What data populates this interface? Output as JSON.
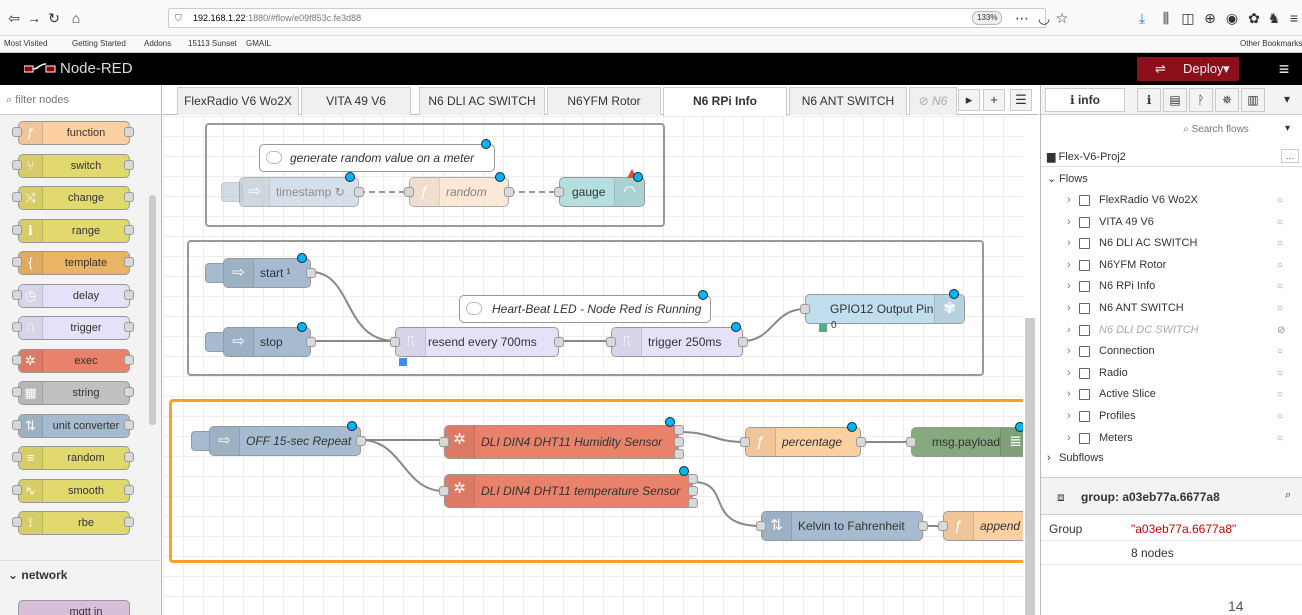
{
  "browser": {
    "url_host": "192.168.1.22",
    "url_path": ":1880/#flow/e09f853c.fe3d88",
    "zoom": "133%",
    "bookmarks": [
      "Most Visited",
      "Getting Started",
      "Addons",
      "15113 Sunset",
      "GMAIL"
    ],
    "other_bookmarks": "Other Bookmarks"
  },
  "header": {
    "title": "Node-RED",
    "deploy_label": "Deploy"
  },
  "palette": {
    "filter_placeholder": "filter nodes",
    "nodes": [
      {
        "label": "function",
        "color": "#fdd0a2",
        "icon": "function-icon",
        "glyph": "ƒ"
      },
      {
        "label": "switch",
        "color": "#e2d96e",
        "icon": "switch-icon",
        "glyph": "⑂"
      },
      {
        "label": "change",
        "color": "#e2d96e",
        "icon": "change-icon",
        "glyph": "⤨"
      },
      {
        "label": "range",
        "color": "#e2d96e",
        "icon": "range-icon",
        "glyph": "ℹ"
      },
      {
        "label": "template",
        "color": "#ebb464",
        "icon": "template-icon",
        "glyph": "{"
      },
      {
        "label": "delay",
        "color": "#e6e0f8",
        "icon": "delay-icon",
        "glyph": "◷"
      },
      {
        "label": "trigger",
        "color": "#e6e0f8",
        "icon": "trigger-icon",
        "glyph": "⎍"
      },
      {
        "label": "exec",
        "color": "#e8826b",
        "icon": "exec-icon",
        "glyph": "✲"
      },
      {
        "label": "string",
        "color": "#c0c0c0",
        "icon": "string-icon",
        "glyph": "▦"
      },
      {
        "label": "unit converter",
        "color": "#a6bbcf",
        "icon": "unit-converter-icon",
        "glyph": "⇅"
      },
      {
        "label": "random",
        "color": "#e2d96e",
        "icon": "random-icon",
        "glyph": "≡"
      },
      {
        "label": "smooth",
        "color": "#e2d96e",
        "icon": "smooth-icon",
        "glyph": "∿"
      },
      {
        "label": "rbe",
        "color": "#e2d96e",
        "icon": "rbe-icon",
        "glyph": "⟟"
      }
    ],
    "category": "network",
    "partial_node": "mqtt in"
  },
  "tabs": [
    {
      "label": "FlexRadio V6 Wo2X",
      "active": false
    },
    {
      "label": "VITA 49 V6",
      "active": false
    },
    {
      "label": "N6 DLI AC SWITCH",
      "active": false
    },
    {
      "label": "N6YFM Rotor",
      "active": false
    },
    {
      "label": "N6 RPi Info",
      "active": true
    },
    {
      "label": "N6 ANT SWITCH",
      "active": false
    },
    {
      "label": "N6",
      "active": false,
      "disabled": true
    }
  ],
  "flow": {
    "group1": {
      "comment": "generate random value on a meter",
      "timestamp": "timestamp ↻",
      "random": "random",
      "gauge": "gauge"
    },
    "group2": {
      "start": "start ¹",
      "stop": "stop",
      "comment": "Heart-Beat LED - Node Red is Running",
      "resend": "resend every 700ms",
      "trigger": "trigger 250ms",
      "gpio": "GPIO12 Output Pin",
      "gpio_status": "0"
    },
    "group3": {
      "inject": "OFF 15-sec Repeat",
      "humidity": "DLI DIN4 DHT11 Humidity Sensor",
      "temperature": "DLI DIN4 DHT11 temperature Sensor",
      "percentage": "percentage",
      "msg_payload": "msg.payload",
      "kelvin": "Kelvin to Fahrenheit",
      "append": "append F"
    }
  },
  "sidebar": {
    "tab_label": "info",
    "search_placeholder": "Search flows",
    "project": "Flex-V6-Proj2",
    "flows_label": "Flows",
    "flows": [
      {
        "name": "FlexRadio V6 Wo2X",
        "disabled": false
      },
      {
        "name": "VITA 49 V6",
        "disabled": false
      },
      {
        "name": "N6 DLI AC SWITCH",
        "disabled": false
      },
      {
        "name": "N6YFM Rotor",
        "disabled": false
      },
      {
        "name": "N6 RPi Info",
        "disabled": false
      },
      {
        "name": "N6 ANT SWITCH",
        "disabled": false
      },
      {
        "name": "N6 DLI DC SWITCH",
        "disabled": true
      },
      {
        "name": "Connection",
        "disabled": false
      },
      {
        "name": "Radio",
        "disabled": false
      },
      {
        "name": "Active Slice",
        "disabled": false
      },
      {
        "name": "Profiles",
        "disabled": false
      },
      {
        "name": "Meters",
        "disabled": false
      }
    ],
    "subflows_label": "Subflows",
    "group_title": "group: a03eb77a.6677a8",
    "props": [
      {
        "key": "Group",
        "value": "\"a03eb77a.6677a8\""
      },
      {
        "key": "",
        "value": "8 nodes"
      }
    ]
  },
  "page_number": "14"
}
